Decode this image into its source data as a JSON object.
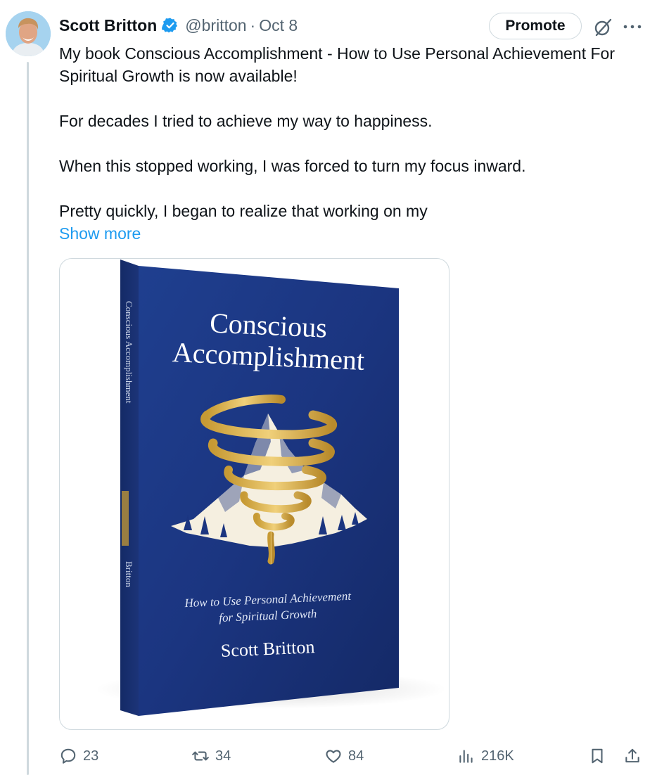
{
  "tweet": {
    "author_name": "Scott Britton",
    "handle": "@britton",
    "separator": "·",
    "date": "Oct 8",
    "promote_label": "Promote",
    "paragraphs": [
      "My book Conscious Accomplishment - How to Use Personal Achievement For Spiritual Growth is now available!",
      "For decades I tried to achieve my way to happiness.",
      "When this stopped working, I was forced to turn my focus inward.",
      "Pretty quickly, I began to realize that working on my"
    ],
    "show_more": "Show more"
  },
  "book_cover": {
    "title_line1": "Conscious",
    "title_line2": "Accomplishment",
    "subtitle_line1": "How to Use Personal Achievement",
    "subtitle_line2": "for Spiritual Growth",
    "author": "Scott Britton",
    "spine_title": "Conscious Accomplishment",
    "spine_author": "Britton"
  },
  "actions": {
    "replies": "23",
    "reposts": "34",
    "likes": "84",
    "views": "216K"
  },
  "colors": {
    "link": "#1d9bf0",
    "verified": "#1d9bf0",
    "muted": "#536471",
    "cover_blue": "#1b3580",
    "gold": "#d4ad4a"
  },
  "icons": [
    "verified-badge-icon",
    "grok-icon",
    "more-icon",
    "reply-icon",
    "repost-icon",
    "like-icon",
    "views-icon",
    "bookmark-icon",
    "share-icon"
  ]
}
